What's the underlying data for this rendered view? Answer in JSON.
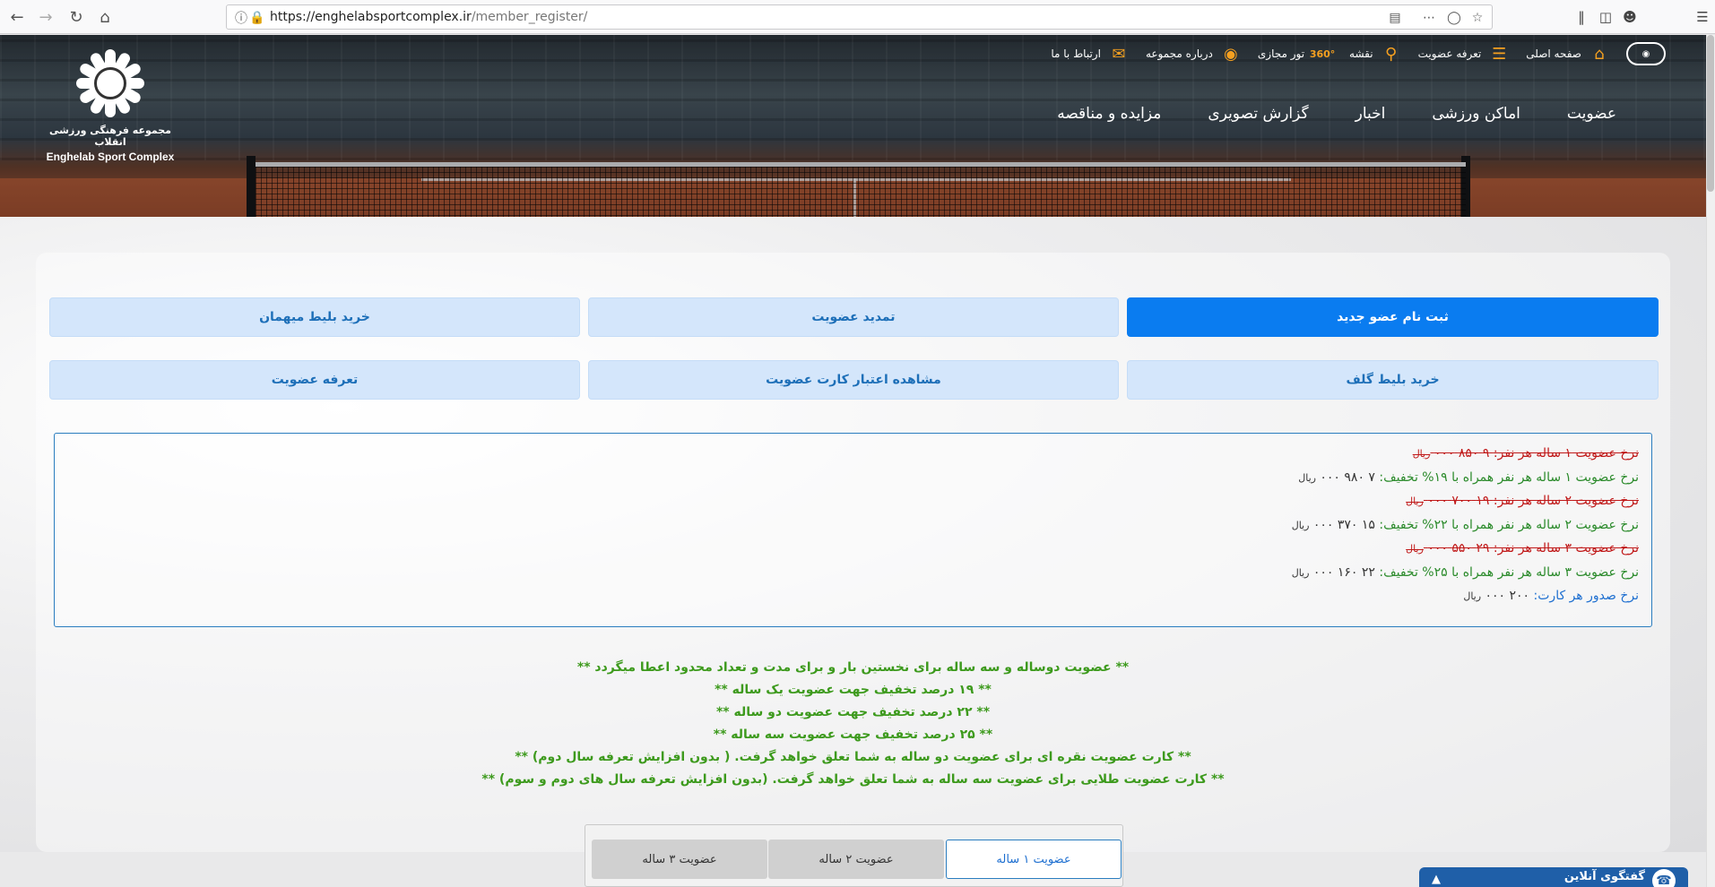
{
  "browser": {
    "url_host": "https://enghelabsportcomplex.ir",
    "url_path": "/member_register/"
  },
  "header": {
    "topnav": [
      {
        "label": "صفحه اصلی",
        "icon": "home-icon"
      },
      {
        "label": "تعرفه عضویت",
        "icon": "list-icon"
      },
      {
        "label": "نقشه",
        "icon": "map-pin-icon"
      },
      {
        "label": "تور مجازی",
        "icon": "360-icon"
      },
      {
        "label": "درباره مجموعه",
        "icon": "info-icon"
      },
      {
        "label": "ارتباط با ما",
        "icon": "mail-icon"
      }
    ],
    "mainnav": [
      "عضویت",
      "اماکن ورزشی",
      "اخبار",
      "گزارش تصویری",
      "مزایده و مناقصه"
    ],
    "logo_fa": "مجموعه فرهنگی ورزشی انقلاب",
    "logo_en": "Enghelab Sport Complex"
  },
  "actions": {
    "new_member": "ثبت نام عضو جدید",
    "renew": "تمدید عضویت",
    "guest_ticket": "خرید بلیط میهمان",
    "golf_ticket": "خرید بلیط گلف",
    "card_validity": "مشاهده اعتبار کارت عضویت",
    "membership_tariff": "تعرفه عضویت"
  },
  "rates": [
    {
      "label": "نرخ عضویت ۱ ساله هر نفر:",
      "value": "۹ ۸۵۰ ۰۰۰",
      "unit": "ریال",
      "style": "old"
    },
    {
      "label": "نرخ عضویت ۱ ساله هر نفر همراه با ۱۹% تخفیف:",
      "value": "۷ ۹۸۰ ۰۰۰",
      "unit": "ریال",
      "style": "new"
    },
    {
      "label": "نرخ عضویت ۲ ساله هر نفر:",
      "value": "۱۹ ۷۰۰ ۰۰۰",
      "unit": "ریال",
      "style": "old"
    },
    {
      "label": "نرخ عضویت ۲ ساله هر نفر همراه با ۲۲% تخفیف:",
      "value": "۱۵ ۳۷۰ ۰۰۰",
      "unit": "ریال",
      "style": "new"
    },
    {
      "label": "نرخ عضویت ۳ ساله هر نفر:",
      "value": "۲۹ ۵۵۰ ۰۰۰",
      "unit": "ریال",
      "style": "old"
    },
    {
      "label": "نرخ عضویت ۳ ساله هر نفر همراه با ۲۵% تخفیف:",
      "value": "۲۲ ۱۶۰ ۰۰۰",
      "unit": "ریال",
      "style": "new"
    },
    {
      "label": "نرخ صدور هر کارت:",
      "value": "۲۰۰ ۰۰۰",
      "unit": "ریال",
      "style": "blue"
    }
  ],
  "notes": [
    "** عضویت دوساله و سه ساله برای نخستین بار و برای مدت و تعداد محدود اعطا میگردد **",
    "** ۱۹ درصد تخفیف جهت عضویت یک ساله **",
    "** ۲۲ درصد تخفیف جهت عضویت دو ساله **",
    "** ۲۵ درصد تخفیف جهت عضویت سه ساله **",
    "** کارت عضویت نقره ای برای عضویت دو ساله به شما تعلق خواهد گرفت. ( بدون افزایش تعرفه سال دوم) **",
    "** کارت عضویت طلایی برای عضویت سه ساله به شما تعلق خواهد گرفت. (بدون افزایش تعرفه سال های دوم و سوم) **"
  ],
  "membership_tabs": {
    "one_year": "عضویت ۱ ساله",
    "two_year": "عضویت ۲ ساله",
    "three_year": "عضویت ۳ ساله"
  },
  "chat": {
    "label": "گفتگوی آنلاین"
  }
}
